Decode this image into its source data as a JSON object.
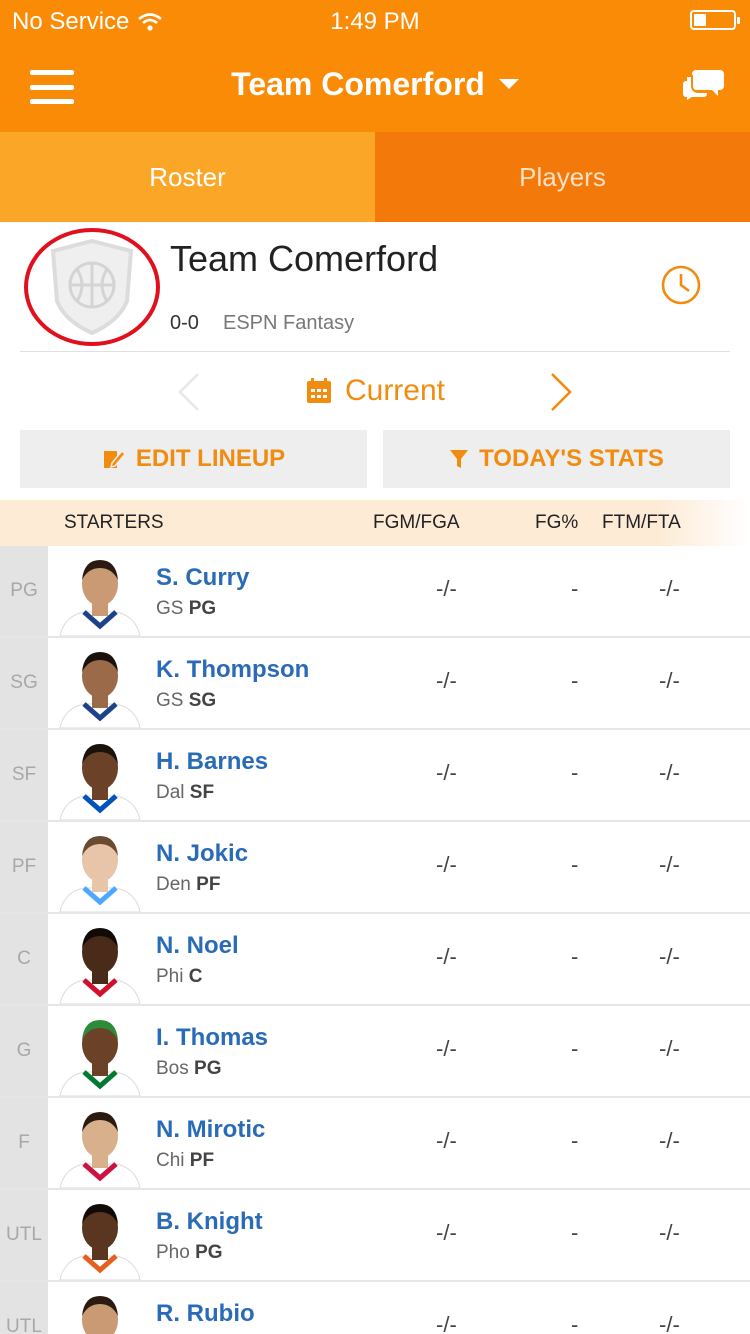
{
  "status_bar": {
    "carrier": "No Service",
    "time": "1:49 PM"
  },
  "header": {
    "title": "Team Comerford"
  },
  "tabs": [
    {
      "label": "Roster"
    },
    {
      "label": "Players"
    }
  ],
  "team": {
    "name": "Team Comerford",
    "record": "0-0",
    "league": "ESPN Fantasy"
  },
  "period": {
    "label": "Current"
  },
  "actions": {
    "edit_lineup": "EDIT LINEUP",
    "todays_stats": "TODAY'S STATS"
  },
  "columns": {
    "section": "STARTERS",
    "c1": "FGM/FGA",
    "c2": "FG%",
    "c3": "FTM/FTA"
  },
  "players": [
    {
      "slot": "PG",
      "name": "S. Curry",
      "team": "GS",
      "position": "PG",
      "fgm_fga": "-/-",
      "fg_pct": "-",
      "ftm_fta": "-/-",
      "skin": "#c99a74",
      "hair": "#2a1a10",
      "jersey": "#ffffff",
      "trim": "#1d428a"
    },
    {
      "slot": "SG",
      "name": "K. Thompson",
      "team": "GS",
      "position": "SG",
      "fgm_fga": "-/-",
      "fg_pct": "-",
      "ftm_fta": "-/-",
      "skin": "#9b6a48",
      "hair": "#1a120c",
      "jersey": "#ffffff",
      "trim": "#1d428a"
    },
    {
      "slot": "SF",
      "name": "H. Barnes",
      "team": "Dal",
      "position": "SF",
      "fgm_fga": "-/-",
      "fg_pct": "-",
      "ftm_fta": "-/-",
      "skin": "#6b4128",
      "hair": "#1a120c",
      "jersey": "#ffffff",
      "trim": "#0053bc"
    },
    {
      "slot": "PF",
      "name": "N. Jokic",
      "team": "Den",
      "position": "PF",
      "fgm_fga": "-/-",
      "fg_pct": "-",
      "ftm_fta": "-/-",
      "skin": "#e8c4a8",
      "hair": "#6a4a30",
      "jersey": "#ffffff",
      "trim": "#4fa8ff"
    },
    {
      "slot": "C",
      "name": "N. Noel",
      "team": "Phi",
      "position": "C",
      "fgm_fga": "-/-",
      "fg_pct": "-",
      "ftm_fta": "-/-",
      "skin": "#4a2a18",
      "hair": "#120a06",
      "jersey": "#ffffff",
      "trim": "#d0102c"
    },
    {
      "slot": "G",
      "name": "I. Thomas",
      "team": "Bos",
      "position": "PG",
      "fgm_fga": "-/-",
      "fg_pct": "-",
      "ftm_fta": "-/-",
      "skin": "#6b4128",
      "hair": "#2e8b3a",
      "jersey": "#ffffff",
      "trim": "#007a33"
    },
    {
      "slot": "F",
      "name": "N. Mirotic",
      "team": "Chi",
      "position": "PF",
      "fgm_fga": "-/-",
      "fg_pct": "-",
      "ftm_fta": "-/-",
      "skin": "#d9b08c",
      "hair": "#2a1a10",
      "jersey": "#ffffff",
      "trim": "#ce1141"
    },
    {
      "slot": "UTL",
      "name": "B. Knight",
      "team": "Pho",
      "position": "PG",
      "fgm_fga": "-/-",
      "fg_pct": "-",
      "ftm_fta": "-/-",
      "skin": "#5a3520",
      "hair": "#120a06",
      "jersey": "#ffffff",
      "trim": "#e56020"
    },
    {
      "slot": "UTL",
      "name": "R. Rubio",
      "team": "",
      "position": "",
      "fgm_fga": "-/-",
      "fg_pct": "-",
      "ftm_fta": "-/-",
      "skin": "#c99a74",
      "hair": "#2a1a10",
      "jersey": "#ffffff",
      "trim": "#0c2340"
    }
  ],
  "colors": {
    "brand_orange": "#f98b07",
    "tab_active": "#fba626",
    "accent_text": "#f08c10",
    "link_blue": "#2a6bb8",
    "highlight_circle": "#e0101c"
  },
  "icons": {
    "menu": "hamburger-icon",
    "chat": "chat-bubbles-icon",
    "clock": "clock-icon",
    "calendar": "calendar-icon",
    "edit": "edit-icon",
    "filter": "filter-icon",
    "wifi": "wifi-icon",
    "battery": "battery-icon"
  }
}
